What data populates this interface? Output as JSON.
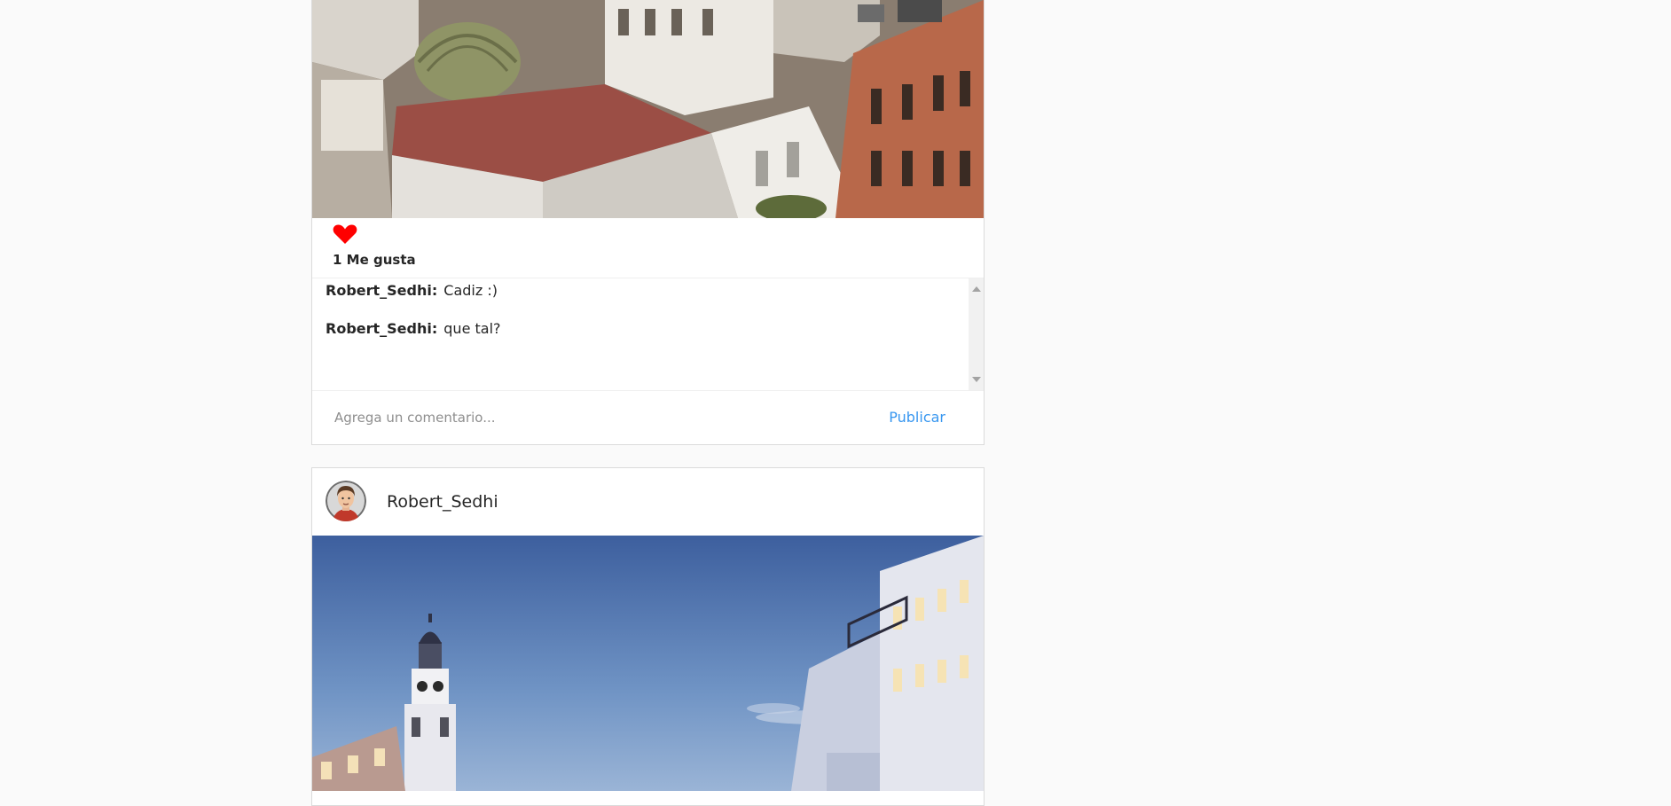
{
  "post_1": {
    "photo_icon": "rooftops-photo",
    "like_icon": "heart-icon",
    "like_color": "#ff0000",
    "likes_label": "1 Me gusta",
    "comments": [
      {
        "author": "Robert_Sedhi:",
        "text": "Cadiz :)"
      },
      {
        "author": "Robert_Sedhi:",
        "text": "que tal?"
      }
    ],
    "comment_placeholder": "Agrega un comentario...",
    "publish_label": "Publicar",
    "accent_color": "#3897f0"
  },
  "post_2": {
    "avatar_icon": "avatar-icon",
    "username": "Robert_Sedhi",
    "photo_icon": "city-photo"
  }
}
